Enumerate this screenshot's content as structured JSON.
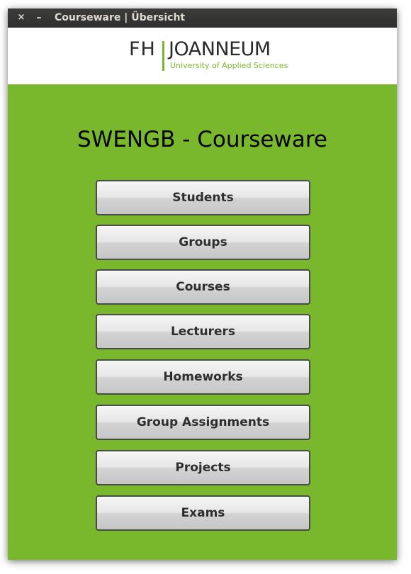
{
  "window": {
    "title": "Courseware | Übersicht",
    "close_glyph": "×",
    "minimize_glyph": "–"
  },
  "logo": {
    "primary": "FH",
    "name": "JOANNEUM",
    "subtitle": "University of Applied Sciences",
    "accent_color": "#79b82c"
  },
  "main": {
    "title": "SWENGB - Courseware",
    "background_color": "#79b82c",
    "buttons": [
      {
        "label": "Students"
      },
      {
        "label": "Groups"
      },
      {
        "label": "Courses"
      },
      {
        "label": "Lecturers"
      },
      {
        "label": "Homeworks"
      },
      {
        "label": "Group Assignments"
      },
      {
        "label": "Projects"
      },
      {
        "label": "Exams"
      }
    ]
  }
}
